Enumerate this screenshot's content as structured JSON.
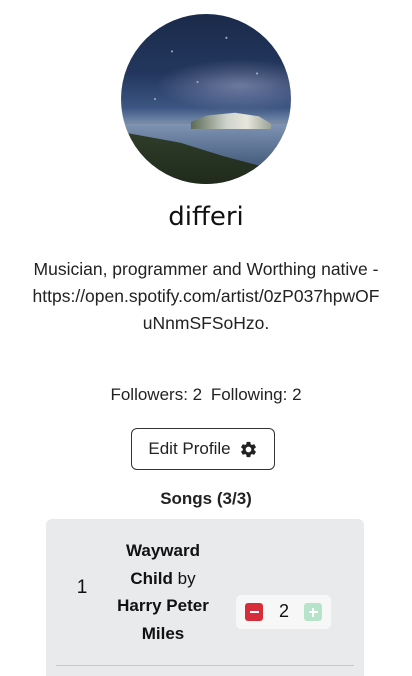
{
  "profile": {
    "username": "differi",
    "bio": "Musician, programmer and Worthing native - https://open.spotify.com/artist/0zP037hpwOFuNnmSFSoHzo.",
    "followers_label": "Followers: 2",
    "following_label": "Following: 2",
    "edit_button_label": "Edit Profile",
    "edit_button_icon": "gear-icon",
    "avatar_description": "night-sky-coastline-photo"
  },
  "songs": {
    "heading": "Songs (3/3)",
    "items": [
      {
        "rank": "1",
        "title": "Wayward Child",
        "by": "by",
        "artist": "Harry Peter Miles",
        "votes": "2"
      }
    ]
  },
  "colors": {
    "minus_button": "#d62d3b",
    "plus_button": "#b8e3cb",
    "list_background": "#e9eaec"
  }
}
